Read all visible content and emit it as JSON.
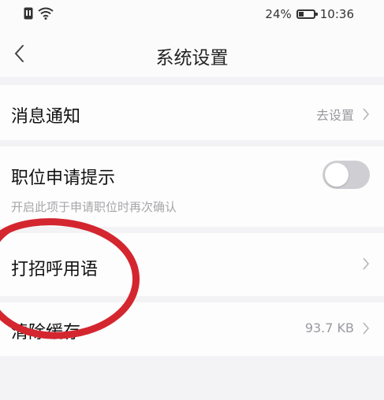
{
  "status_bar": {
    "battery_percent": "24%",
    "time": "10:36",
    "icons": [
      "sim-icon",
      "wifi-icon",
      "battery-icon"
    ]
  },
  "navbar": {
    "back_icon": "chevron-left-icon",
    "title": "系统设置"
  },
  "settings": {
    "message_notification": {
      "label": "消息通知",
      "action": "去设置"
    },
    "job_application_prompt": {
      "label": "职位申请提示",
      "subtitle": "开启此项于申请职位时再次确认",
      "toggle_on": false
    },
    "greeting_phrases": {
      "label": "打招呼用语"
    },
    "clear_cache": {
      "label": "清除缓存",
      "value": "93.7 KB"
    }
  },
  "colors": {
    "annotation_circle": "#d4262f",
    "background": "#f3f3f5",
    "row_background": "#fdfdfd"
  }
}
